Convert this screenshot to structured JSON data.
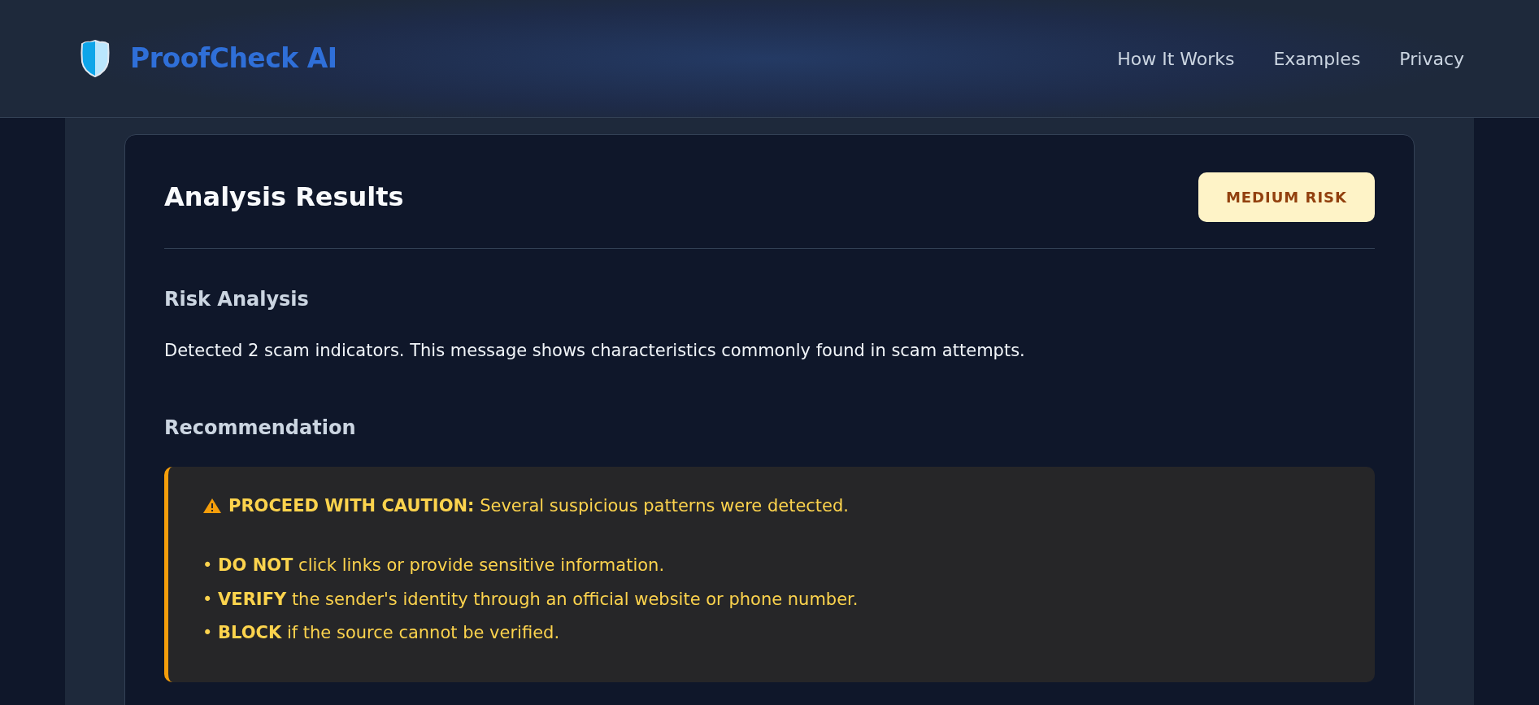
{
  "header": {
    "brand": "ProofCheck AI",
    "nav": [
      {
        "label": "How It Works"
      },
      {
        "label": "Examples"
      },
      {
        "label": "Privacy"
      }
    ]
  },
  "results": {
    "title": "Analysis Results",
    "risk_badge": {
      "label": "MEDIUM RISK"
    },
    "sections": [
      {
        "heading": "Risk Analysis",
        "text": "Detected 2 scam indicators. This message shows characteristics commonly found in scam attempts."
      },
      {
        "heading": "Recommendation"
      }
    ],
    "recommendation": {
      "headline": "**PROCEED WITH CAUTION:** Several suspicious patterns were detected.",
      "bullets": [
        "• **DO NOT** click links or provide sensitive information.",
        "• **VERIFY** the sender's identity through an official website or phone number.",
        "• **BLOCK** if the source cannot be verified."
      ]
    }
  }
}
